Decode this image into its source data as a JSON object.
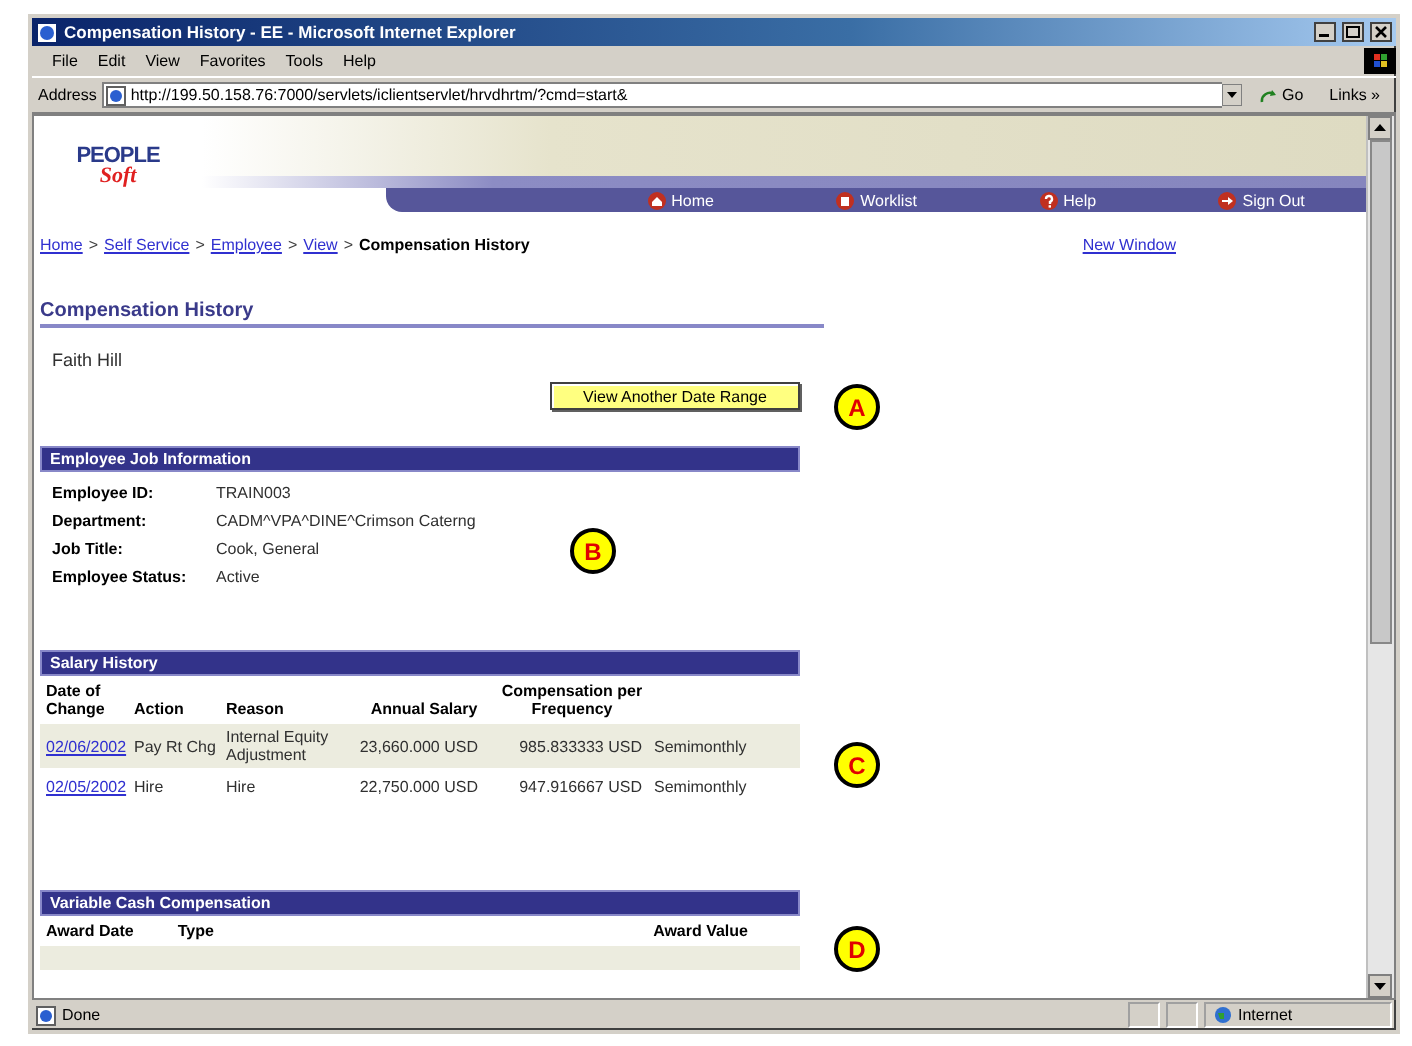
{
  "window": {
    "title": "Compensation History - EE - Microsoft Internet Explorer"
  },
  "menu": [
    "File",
    "Edit",
    "View",
    "Favorites",
    "Tools",
    "Help"
  ],
  "address": {
    "label": "Address",
    "value": "http://199.50.158.76:7000/servlets/iclientservlet/hrvdhrtm/?cmd=start&",
    "go": "Go",
    "links": "Links »"
  },
  "logo": {
    "top": "PEOPLE",
    "bottom": "Soft"
  },
  "nav": [
    {
      "label": "Home"
    },
    {
      "label": "Worklist"
    },
    {
      "label": "Help"
    },
    {
      "label": "Sign Out"
    }
  ],
  "breadcrumb": [
    {
      "kind": "link",
      "text": "Home"
    },
    {
      "kind": "separator",
      "text": ">"
    },
    {
      "kind": "link",
      "text": "Self Service"
    },
    {
      "kind": "separator",
      "text": ">"
    },
    {
      "kind": "link",
      "text": "Employee"
    },
    {
      "kind": "separator",
      "text": ">"
    },
    {
      "kind": "link",
      "text": "View"
    },
    {
      "kind": "separator",
      "text": ">"
    },
    {
      "kind": "current",
      "text": "Compensation History"
    }
  ],
  "new_window": "New Window",
  "page_title": "Compensation History",
  "employee_name": "Faith Hill",
  "date_range_button": "View Another Date Range",
  "job_info": {
    "title": "Employee Job Information",
    "fields": [
      {
        "label": "Employee ID:",
        "value": "TRAIN003"
      },
      {
        "label": "Department:",
        "value": "CADM^VPA^DINE^Crimson Caterng"
      },
      {
        "label": "Job Title:",
        "value": "Cook, General"
      },
      {
        "label": "Employee Status:",
        "value": "Active"
      }
    ]
  },
  "salary_history": {
    "title": "Salary History",
    "columns": [
      "Date of Change",
      "Action",
      "Reason",
      "Annual Salary",
      "Compensation per Frequency"
    ],
    "rows": [
      {
        "date": "02/06/2002",
        "action": "Pay Rt Chg",
        "reason": "Internal Equity Adjustment",
        "annual_salary": "23,660.000 USD",
        "compensation": "985.833333 USD",
        "frequency": "Semimonthly"
      },
      {
        "date": "02/05/2002",
        "action": "Hire",
        "reason": "Hire",
        "annual_salary": "22,750.000 USD",
        "compensation": "947.916667 USD",
        "frequency": "Semimonthly"
      }
    ]
  },
  "variable_cash": {
    "title": "Variable Cash Compensation",
    "columns": [
      "Award Date",
      "Type",
      "Award Value"
    ]
  },
  "callouts": [
    "A",
    "B",
    "C",
    "D"
  ],
  "status": {
    "text": "Done",
    "zone": "Internet"
  }
}
